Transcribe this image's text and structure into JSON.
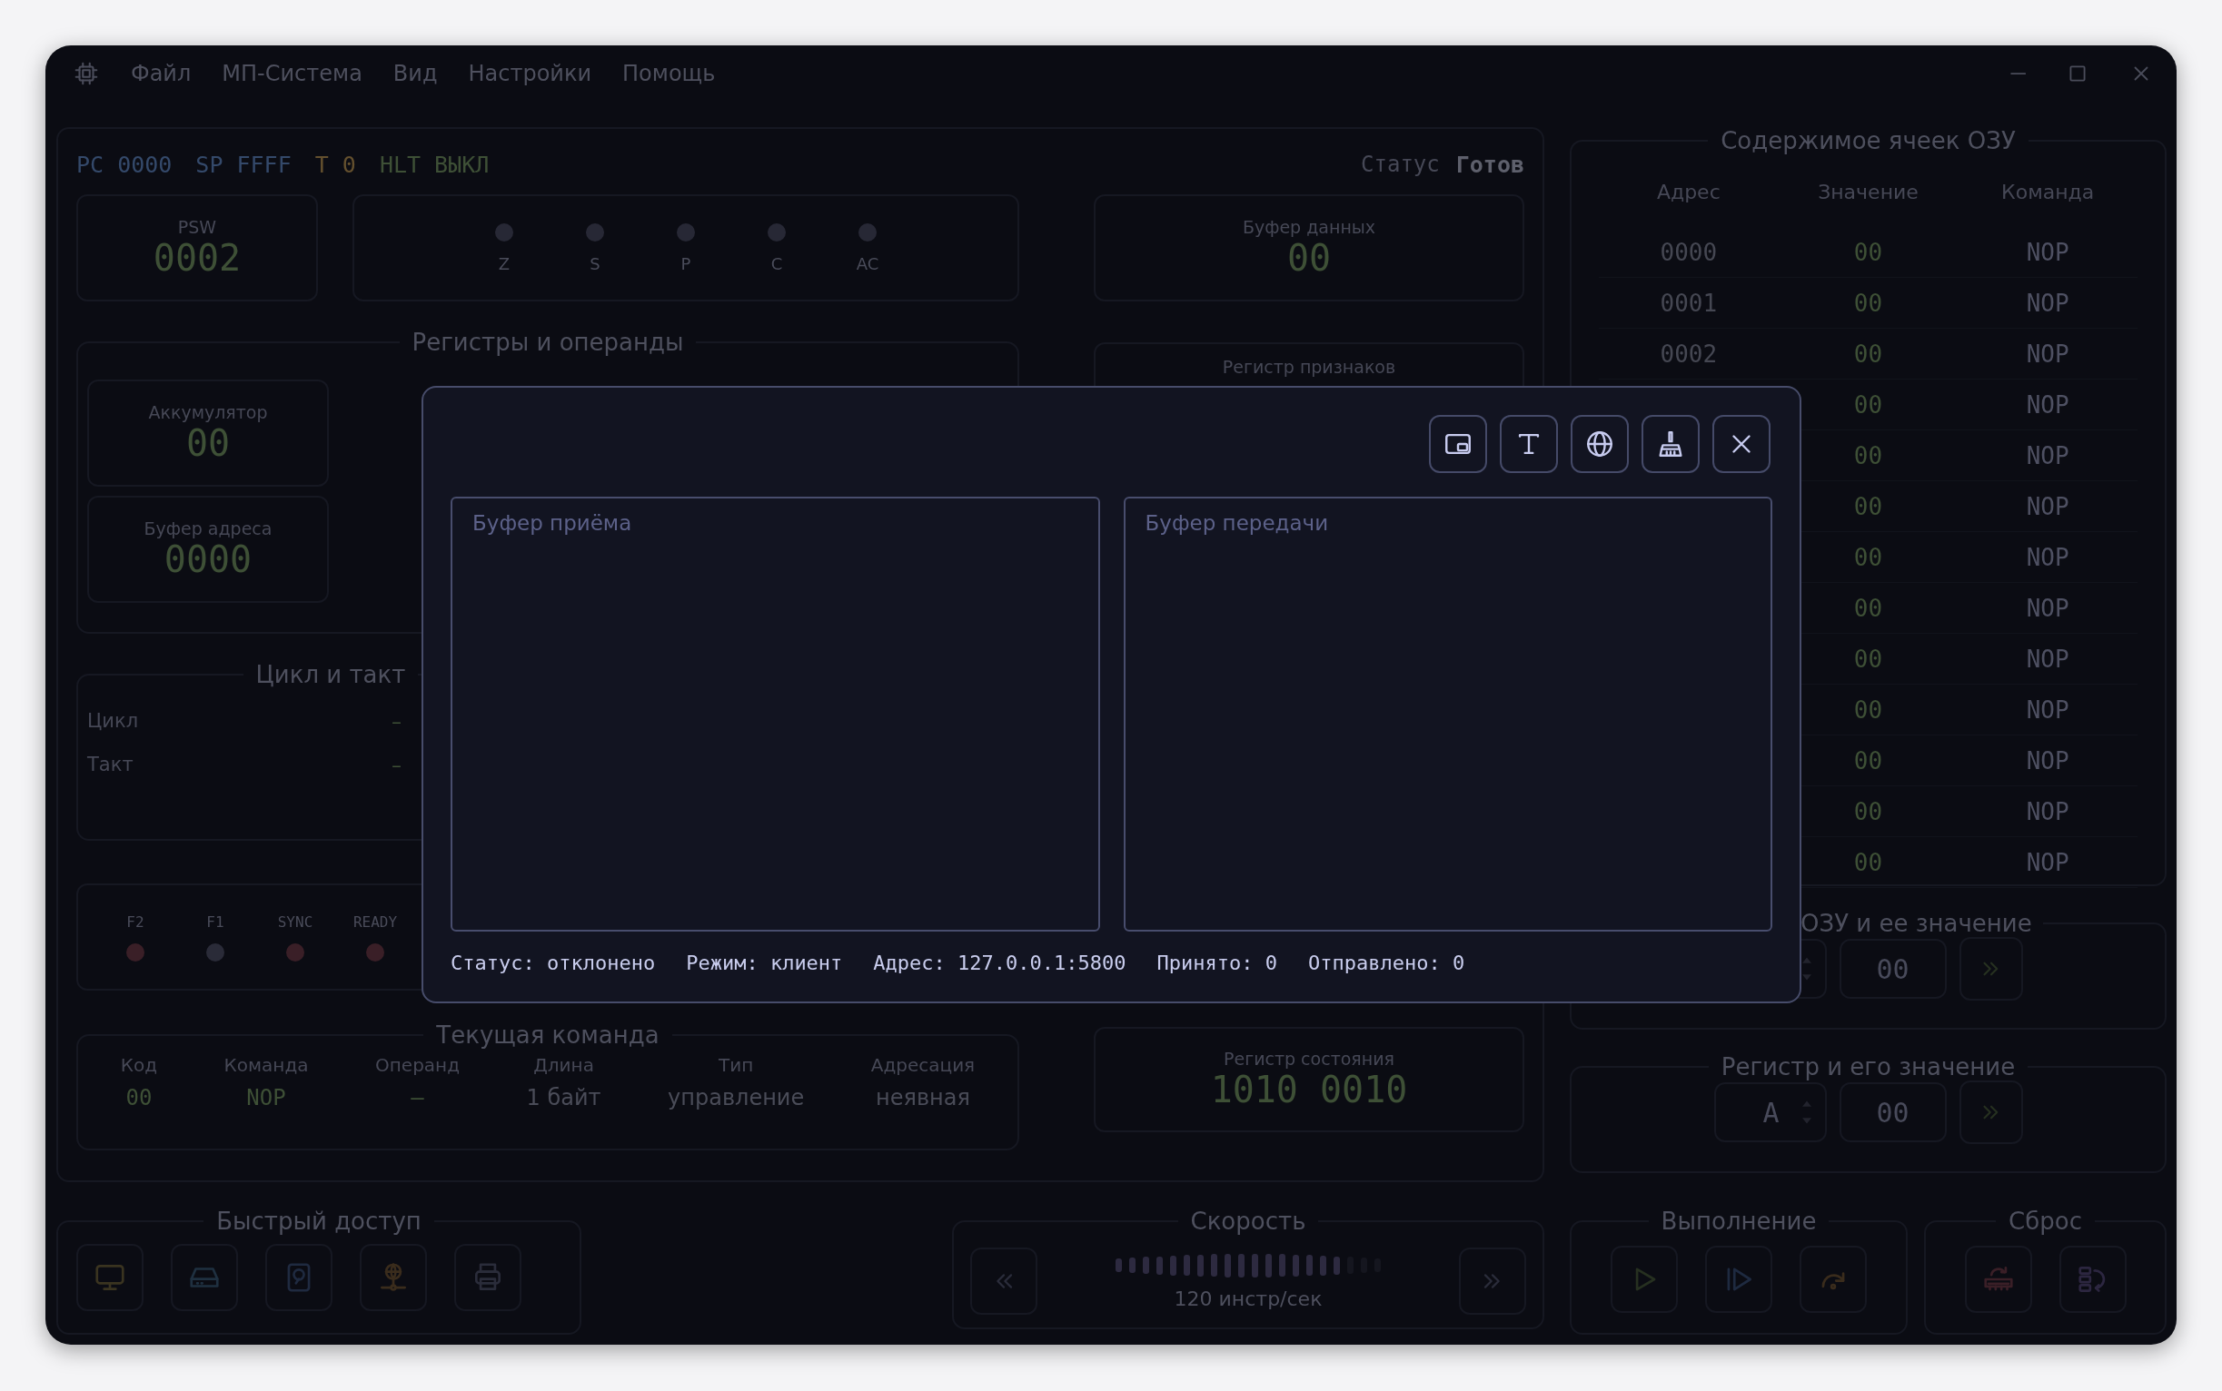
{
  "window": {
    "menu": [
      "Файл",
      "МП-Система",
      "Вид",
      "Настройки",
      "Помощь"
    ]
  },
  "status_line": {
    "registers": [
      {
        "text": "PC 0000",
        "color": "#34496a"
      },
      {
        "text": "SP FFFF",
        "color": "#34496a"
      },
      {
        "text": "T 0",
        "color": "#64502e"
      },
      {
        "text": "HLT ВЫКЛ",
        "color": "#3e5036"
      }
    ],
    "status_label": "Статус",
    "status_value": "Готов"
  },
  "psw": {
    "label": "PSW",
    "value": "0002"
  },
  "flags": [
    {
      "label": "Z",
      "on": false
    },
    {
      "label": "S",
      "on": false
    },
    {
      "label": "P",
      "on": false
    },
    {
      "label": "C",
      "on": false
    },
    {
      "label": "AC",
      "on": false
    }
  ],
  "data_buffer": {
    "label": "Буфер данных",
    "value": "00"
  },
  "registers_group": {
    "title": "Регистры и операнды",
    "cards": [
      {
        "label": "Аккумулятор",
        "value": "00"
      },
      {
        "label": "Буфер адреса",
        "value": "0000"
      }
    ]
  },
  "flags_register": {
    "label": "Регистр признаков"
  },
  "cycle_group": {
    "title": "Цикл и такт",
    "rows": [
      {
        "label": "Цикл",
        "value": "–"
      },
      {
        "label": "Такт",
        "value": "–"
      }
    ]
  },
  "signals": [
    {
      "label": "F2",
      "color": "#3a1f27"
    },
    {
      "label": "F1",
      "color": "#2a2b38"
    },
    {
      "label": "SYNC",
      "color": "#3a1f27"
    },
    {
      "label": "READY",
      "color": "#3a1f27"
    }
  ],
  "current_command": {
    "title": "Текущая команда",
    "columns": [
      {
        "label": "Код",
        "value": "00",
        "kind": "code"
      },
      {
        "label": "Команда",
        "value": "NOP",
        "kind": "code"
      },
      {
        "label": "Операнд",
        "value": "–",
        "kind": "code"
      },
      {
        "label": "Длина",
        "value": "1 байт",
        "kind": "text"
      },
      {
        "label": "Тип",
        "value": "управление",
        "kind": "text"
      },
      {
        "label": "Адресация",
        "value": "неявная",
        "kind": "text"
      }
    ]
  },
  "status_register": {
    "label": "Регистр состояния",
    "value": "1010 0010"
  },
  "ram": {
    "title": "Содержимое ячеек ОЗУ",
    "columns": [
      "Адрес",
      "Значение",
      "Команда"
    ],
    "rows": [
      {
        "address": "0000",
        "value": "00",
        "command": "NOP"
      },
      {
        "address": "0001",
        "value": "00",
        "command": "NOP"
      },
      {
        "address": "0002",
        "value": "00",
        "command": "NOP"
      },
      {
        "value": "00",
        "command": "NOP"
      },
      {
        "value": "00",
        "command": "NOP"
      },
      {
        "value": "00",
        "command": "NOP"
      },
      {
        "value": "00",
        "command": "NOP"
      },
      {
        "value": "00",
        "command": "NOP"
      },
      {
        "value": "00",
        "command": "NOP"
      },
      {
        "value": "00",
        "command": "NOP"
      },
      {
        "value": "00",
        "command": "NOP"
      },
      {
        "value": "00",
        "command": "NOP"
      },
      {
        "value": "00",
        "command": "NOP"
      }
    ]
  },
  "ram_edit": {
    "title": "ОЗУ и ее значение",
    "value": "00"
  },
  "register_edit": {
    "title": "Регистр и его значение",
    "register": "A",
    "value": "00"
  },
  "quick_access": {
    "title": "Быстрый доступ",
    "buttons": [
      {
        "kind": "monitor"
      },
      {
        "kind": "drive"
      },
      {
        "kind": "disk"
      },
      {
        "kind": "network"
      },
      {
        "kind": "printer"
      }
    ]
  },
  "speed": {
    "title": "Скорость",
    "level": 0.85,
    "reading": "120 инстр/сек"
  },
  "execution": {
    "title": "Выполнение",
    "buttons": [
      {
        "kind": "run"
      },
      {
        "kind": "step"
      },
      {
        "kind": "step_over"
      }
    ]
  },
  "reset": {
    "title": "Сброс",
    "buttons": [
      {
        "kind": "memory"
      },
      {
        "kind": "registers"
      }
    ]
  },
  "dialog": {
    "tools": [
      {
        "kind": "window"
      },
      {
        "kind": "text"
      },
      {
        "kind": "network"
      },
      {
        "kind": "clear"
      },
      {
        "kind": "close"
      }
    ],
    "receive": {
      "placeholder": "Буфер приёма"
    },
    "send": {
      "placeholder": "Буфер передачи"
    },
    "status": [
      "Статус: отклонено",
      "Режим: клиент",
      "Адрес: 127.0.0.1:5800",
      "Принято: 0",
      "Отправлено: 0"
    ]
  }
}
